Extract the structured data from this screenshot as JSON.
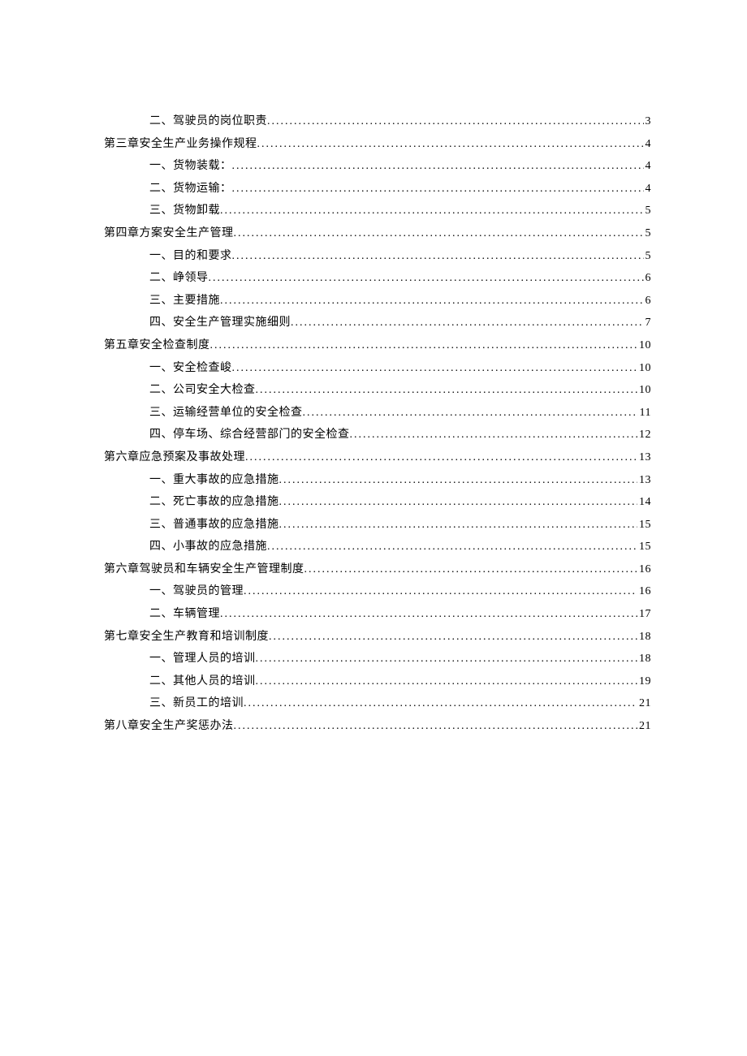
{
  "toc": [
    {
      "indent": 2,
      "label": "二、驾驶员的岗位职责",
      "page": "3"
    },
    {
      "indent": 1,
      "label": "第三章安全生产业务操作规程",
      "page": "4"
    },
    {
      "indent": 2,
      "label": "一、货物装载：",
      "page": "4"
    },
    {
      "indent": 2,
      "label": "二、货物运输：",
      "page": "4"
    },
    {
      "indent": 2,
      "label": "三、货物卸载",
      "page": "5"
    },
    {
      "indent": 1,
      "label": "第四章方案安全生产管理",
      "page": "5"
    },
    {
      "indent": 2,
      "label": "一、目的和要求",
      "page": "5"
    },
    {
      "indent": 2,
      "label": "二、峥领导",
      "page": "6"
    },
    {
      "indent": 2,
      "label": "三、主要措施",
      "page": "6"
    },
    {
      "indent": 2,
      "label": "四、安全生产管理实施细则",
      "page": "7"
    },
    {
      "indent": 1,
      "label": "第五章安全检查制度",
      "page": "10"
    },
    {
      "indent": 2,
      "label": "一、安全检查峻",
      "page": "10"
    },
    {
      "indent": 2,
      "label": "二、公司安全大检查",
      "page": "10"
    },
    {
      "indent": 2,
      "label": "三、运输经营单位的安全检查",
      "page": "11"
    },
    {
      "indent": 2,
      "label": "四、停车场、综合经营部门的安全检查",
      "page": "12"
    },
    {
      "indent": 1,
      "label": "第六章应急预案及事故处理",
      "page": "13"
    },
    {
      "indent": 2,
      "label": "一、重大事故的应急措施",
      "page": "13"
    },
    {
      "indent": 2,
      "label": "二、死亡事故的应急措施",
      "page": "14"
    },
    {
      "indent": 2,
      "label": "三、普通事故的应急措施",
      "page": "15"
    },
    {
      "indent": 2,
      "label": "四、小事故的应急措施",
      "page": "15"
    },
    {
      "indent": 1,
      "label": "第六章驾驶员和车辆安全生产管理制度",
      "page": "16"
    },
    {
      "indent": 2,
      "label": "一、驾驶员的管理",
      "page": "16"
    },
    {
      "indent": 2,
      "label": "二、车辆管理",
      "page": "17"
    },
    {
      "indent": 1,
      "label": "第七章安全生产教育和培训制度",
      "page": "18"
    },
    {
      "indent": 2,
      "label": "一、管理人员的培训",
      "page": "18"
    },
    {
      "indent": 2,
      "label": "二、其他人员的培训",
      "page": "19"
    },
    {
      "indent": 2,
      "label": "三、新员工的培训",
      "page": "21"
    },
    {
      "indent": 1,
      "label": "第八章安全生产奖惩办法",
      "page": "21"
    }
  ]
}
